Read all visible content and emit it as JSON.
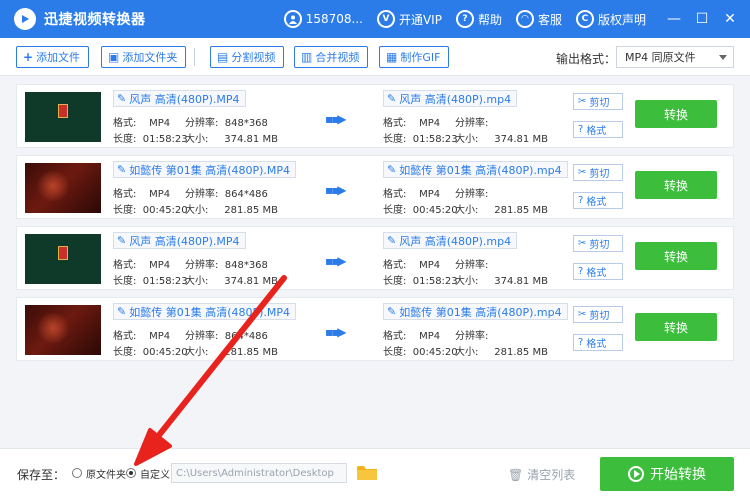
{
  "app": {
    "title": "迅捷视频转换器"
  },
  "header": {
    "user": "158708...",
    "vip": "开通VIP",
    "help": "帮助",
    "service": "客服",
    "copyright": "版权声明"
  },
  "toolbar": {
    "add_file": "添加文件",
    "add_folder": "添加文件夹",
    "split_video": "分割视频",
    "merge_video": "合并视频",
    "make_gif": "制作GIF",
    "output_format_label": "输出格式：",
    "output_format_value": "MP4  同原文件"
  },
  "labels": {
    "format": "格式:",
    "resolution": "分辨率:",
    "duration": "长度:",
    "size": "大小:",
    "cut": "剪切",
    "fmt_btn": "格式",
    "convert": "转换"
  },
  "files": [
    {
      "name": "风声 高清(480P).MP4",
      "out_name": "风声 高清(480P).mp4",
      "format": "MP4",
      "resolution": "848*368",
      "duration": "01:58:23",
      "size": "374.81 MB",
      "thumb": "green"
    },
    {
      "name": "如懿传 第01集 高清(480P).MP4",
      "out_name": "如懿传 第01集 高清(480P).mp4",
      "format": "MP4",
      "resolution": "864*486",
      "duration": "00:45:20",
      "size": "281.85 MB",
      "thumb": "red"
    },
    {
      "name": "风声 高清(480P).MP4",
      "out_name": "风声 高清(480P).mp4",
      "format": "MP4",
      "resolution": "848*368",
      "duration": "01:58:23",
      "size": "374.81 MB",
      "thumb": "green"
    },
    {
      "name": "如懿传 第01集 高清(480P).MP4",
      "out_name": "如懿传 第01集 高清(480P).mp4",
      "format": "MP4",
      "resolution": "864*486",
      "duration": "00:45:20",
      "size": "281.85 MB",
      "thumb": "red"
    }
  ],
  "bottom": {
    "save_to": "保存至：",
    "original_folder": "原文件夹",
    "custom": "自定义",
    "path": "C:\\Users\\Administrator\\Desktop",
    "clear_list": "清空列表",
    "start_convert": "开始转换"
  },
  "colors": {
    "brand": "#2b7ce9",
    "convert": "#3cbe3c",
    "annotation": "#e8231e"
  }
}
